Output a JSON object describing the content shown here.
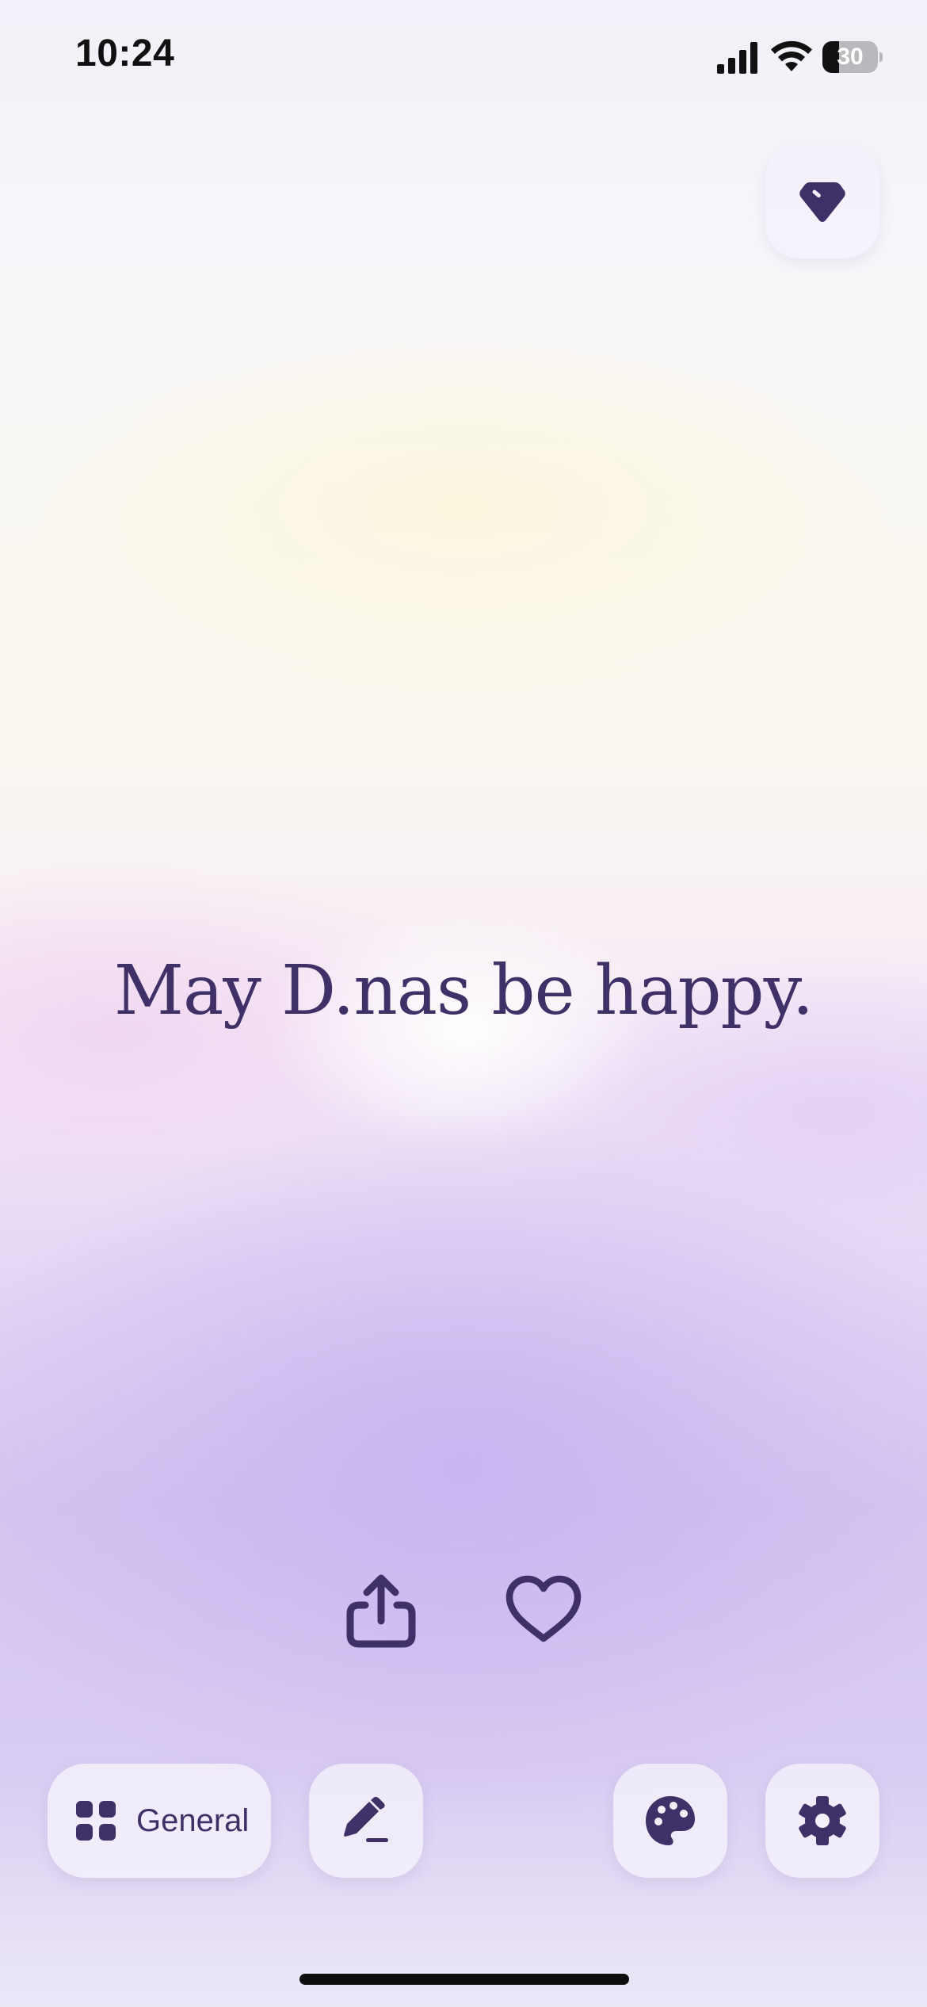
{
  "status_bar": {
    "time": "10:24",
    "battery_level": "30",
    "battery_fraction": 0.3,
    "icons": [
      "signal-icon",
      "wifi-icon",
      "battery-icon"
    ]
  },
  "premium": {
    "icon": "diamond-tag-icon"
  },
  "quote": {
    "text": "May D.nas be happy."
  },
  "actions": {
    "share_icon": "share-icon",
    "like_icon": "heart-icon"
  },
  "bottom_bar": {
    "category_label": "General",
    "category_icon": "grid-icon",
    "edit_icon": "pencil-icon",
    "theme_icon": "palette-icon",
    "settings_icon": "gear-icon"
  },
  "colors": {
    "accent": "#3f3168",
    "button_bg": "#f3f0fa"
  }
}
